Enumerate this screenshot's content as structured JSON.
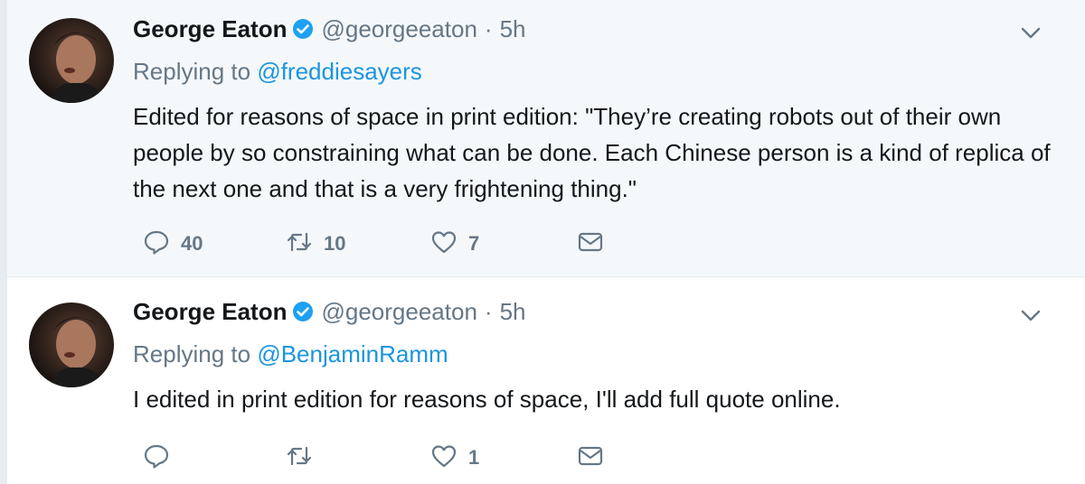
{
  "tweets": [
    {
      "name": "George Eaton",
      "handle": "@georgeeaton",
      "separator": "·",
      "time": "5h",
      "replying_prefix": "Replying to",
      "replying_to": "@freddiesayers",
      "text": "Edited for reasons of space in print edition: \"They’re creating robots out of their own people by so constraining what can be done. Each Chinese person is a kind of replica of the next one and that is a very frightening thing.\"",
      "replies": "40",
      "retweets": "10",
      "likes": "7"
    },
    {
      "name": "George Eaton",
      "handle": "@georgeeaton",
      "separator": "·",
      "time": "5h",
      "replying_prefix": "Replying to",
      "replying_to": "@BenjaminRamm",
      "text": "I edited in print edition for reasons of space, I'll add full quote online.",
      "replies": "",
      "retweets": "",
      "likes": "1"
    }
  ],
  "icons": {
    "verified": "verified-badge-icon",
    "chevron": "chevron-down-icon",
    "reply": "reply-icon",
    "retweet": "retweet-icon",
    "like": "heart-icon",
    "dm": "envelope-icon"
  },
  "colors": {
    "name": "#14171a",
    "muted": "#657786",
    "link": "#1b95e0",
    "verified": "#1da1f2",
    "highlight_bg": "#f5f8fa"
  }
}
